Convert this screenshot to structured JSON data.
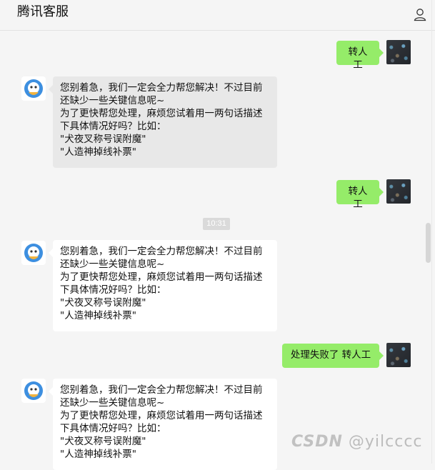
{
  "header": {
    "title": "腾讯客服"
  },
  "messages": [
    {
      "side": "right",
      "text": "转人工"
    },
    {
      "side": "left",
      "lines": [
        "您别着急，我们一定会全力帮您解决！不过目前",
        "还缺少一些关键信息呢~",
        "为了更快帮您处理，麻烦您试着用一两句话描述",
        "下具体情况好吗？比如：",
        "\"犬夜叉称号误附魔\"",
        "\"人造神掉线补票\""
      ]
    },
    {
      "side": "right",
      "text": "转人工"
    },
    {
      "time": "10:31"
    },
    {
      "side": "left",
      "lines": [
        "您别着急，我们一定会全力帮您解决！不过目前",
        "还缺少一些关键信息呢~",
        "为了更快帮您处理，麻烦您试着用一两句话描述",
        "下具体情况好吗？比如：",
        "\"犬夜叉称号误附魔\"",
        "\"人造神掉线补票\""
      ]
    },
    {
      "side": "right",
      "text": "处理失败了 转人工"
    },
    {
      "side": "left",
      "lines": [
        "您别着急，我们一定会全力帮您解决！不过目前",
        "还缺少一些关键信息呢~",
        "为了更快帮您处理，麻烦您试着用一两句话描述",
        "下具体情况好吗？比如：",
        "\"犬夜叉称号误附魔\"",
        "\"人造神掉线补票\""
      ]
    }
  ],
  "watermark": {
    "logo": "CSDN",
    "text": "@yilcccc"
  },
  "colors": {
    "right_bubble": "#95ec69",
    "left_bubble": "#ffffff",
    "bot_blue": "#3d8fe0"
  }
}
